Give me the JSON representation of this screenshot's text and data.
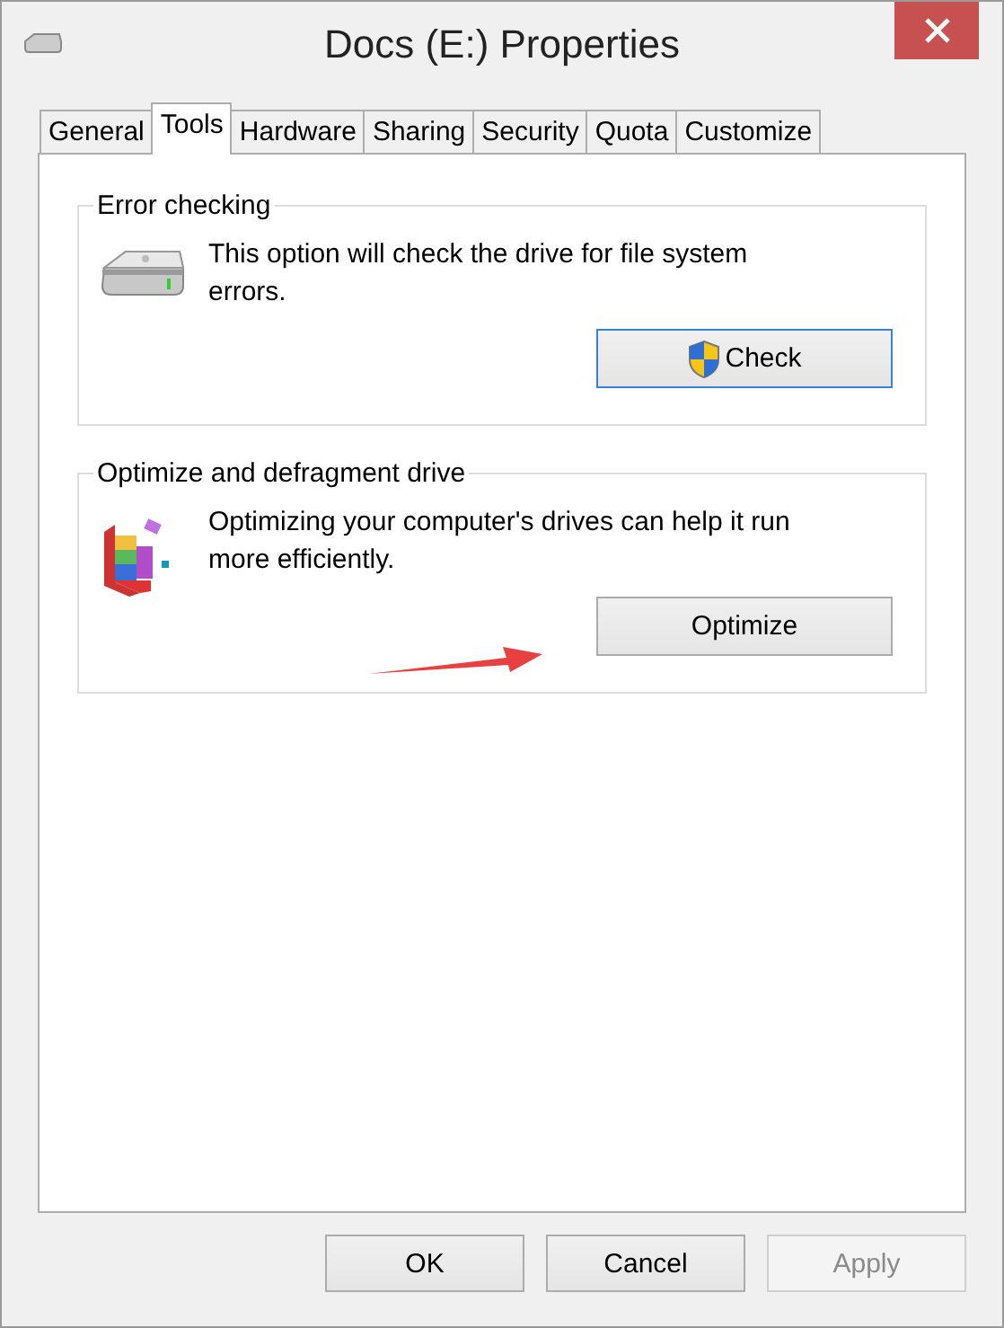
{
  "window": {
    "title": "Docs (E:) Properties"
  },
  "tabs": [
    {
      "label": "General",
      "selected": false
    },
    {
      "label": "Tools",
      "selected": true
    },
    {
      "label": "Hardware",
      "selected": false
    },
    {
      "label": "Sharing",
      "selected": false
    },
    {
      "label": "Security",
      "selected": false
    },
    {
      "label": "Quota",
      "selected": false
    },
    {
      "label": "Customize",
      "selected": false
    }
  ],
  "groups": [
    {
      "title": "Error checking",
      "kind": "drive",
      "description": "This option will check the drive for file system errors.",
      "button": {
        "label": "Check",
        "shield": true,
        "focused": true
      }
    },
    {
      "title": "Optimize and defragment drive",
      "kind": "defrag",
      "description": "Optimizing your computer's drives can help it run more efficiently.",
      "button": {
        "label": "Optimize",
        "shield": false,
        "focused": false
      }
    }
  ],
  "buttons": [
    {
      "label": "OK",
      "disabled": false
    },
    {
      "label": "Cancel",
      "disabled": false
    },
    {
      "label": "Apply",
      "disabled": true
    }
  ]
}
